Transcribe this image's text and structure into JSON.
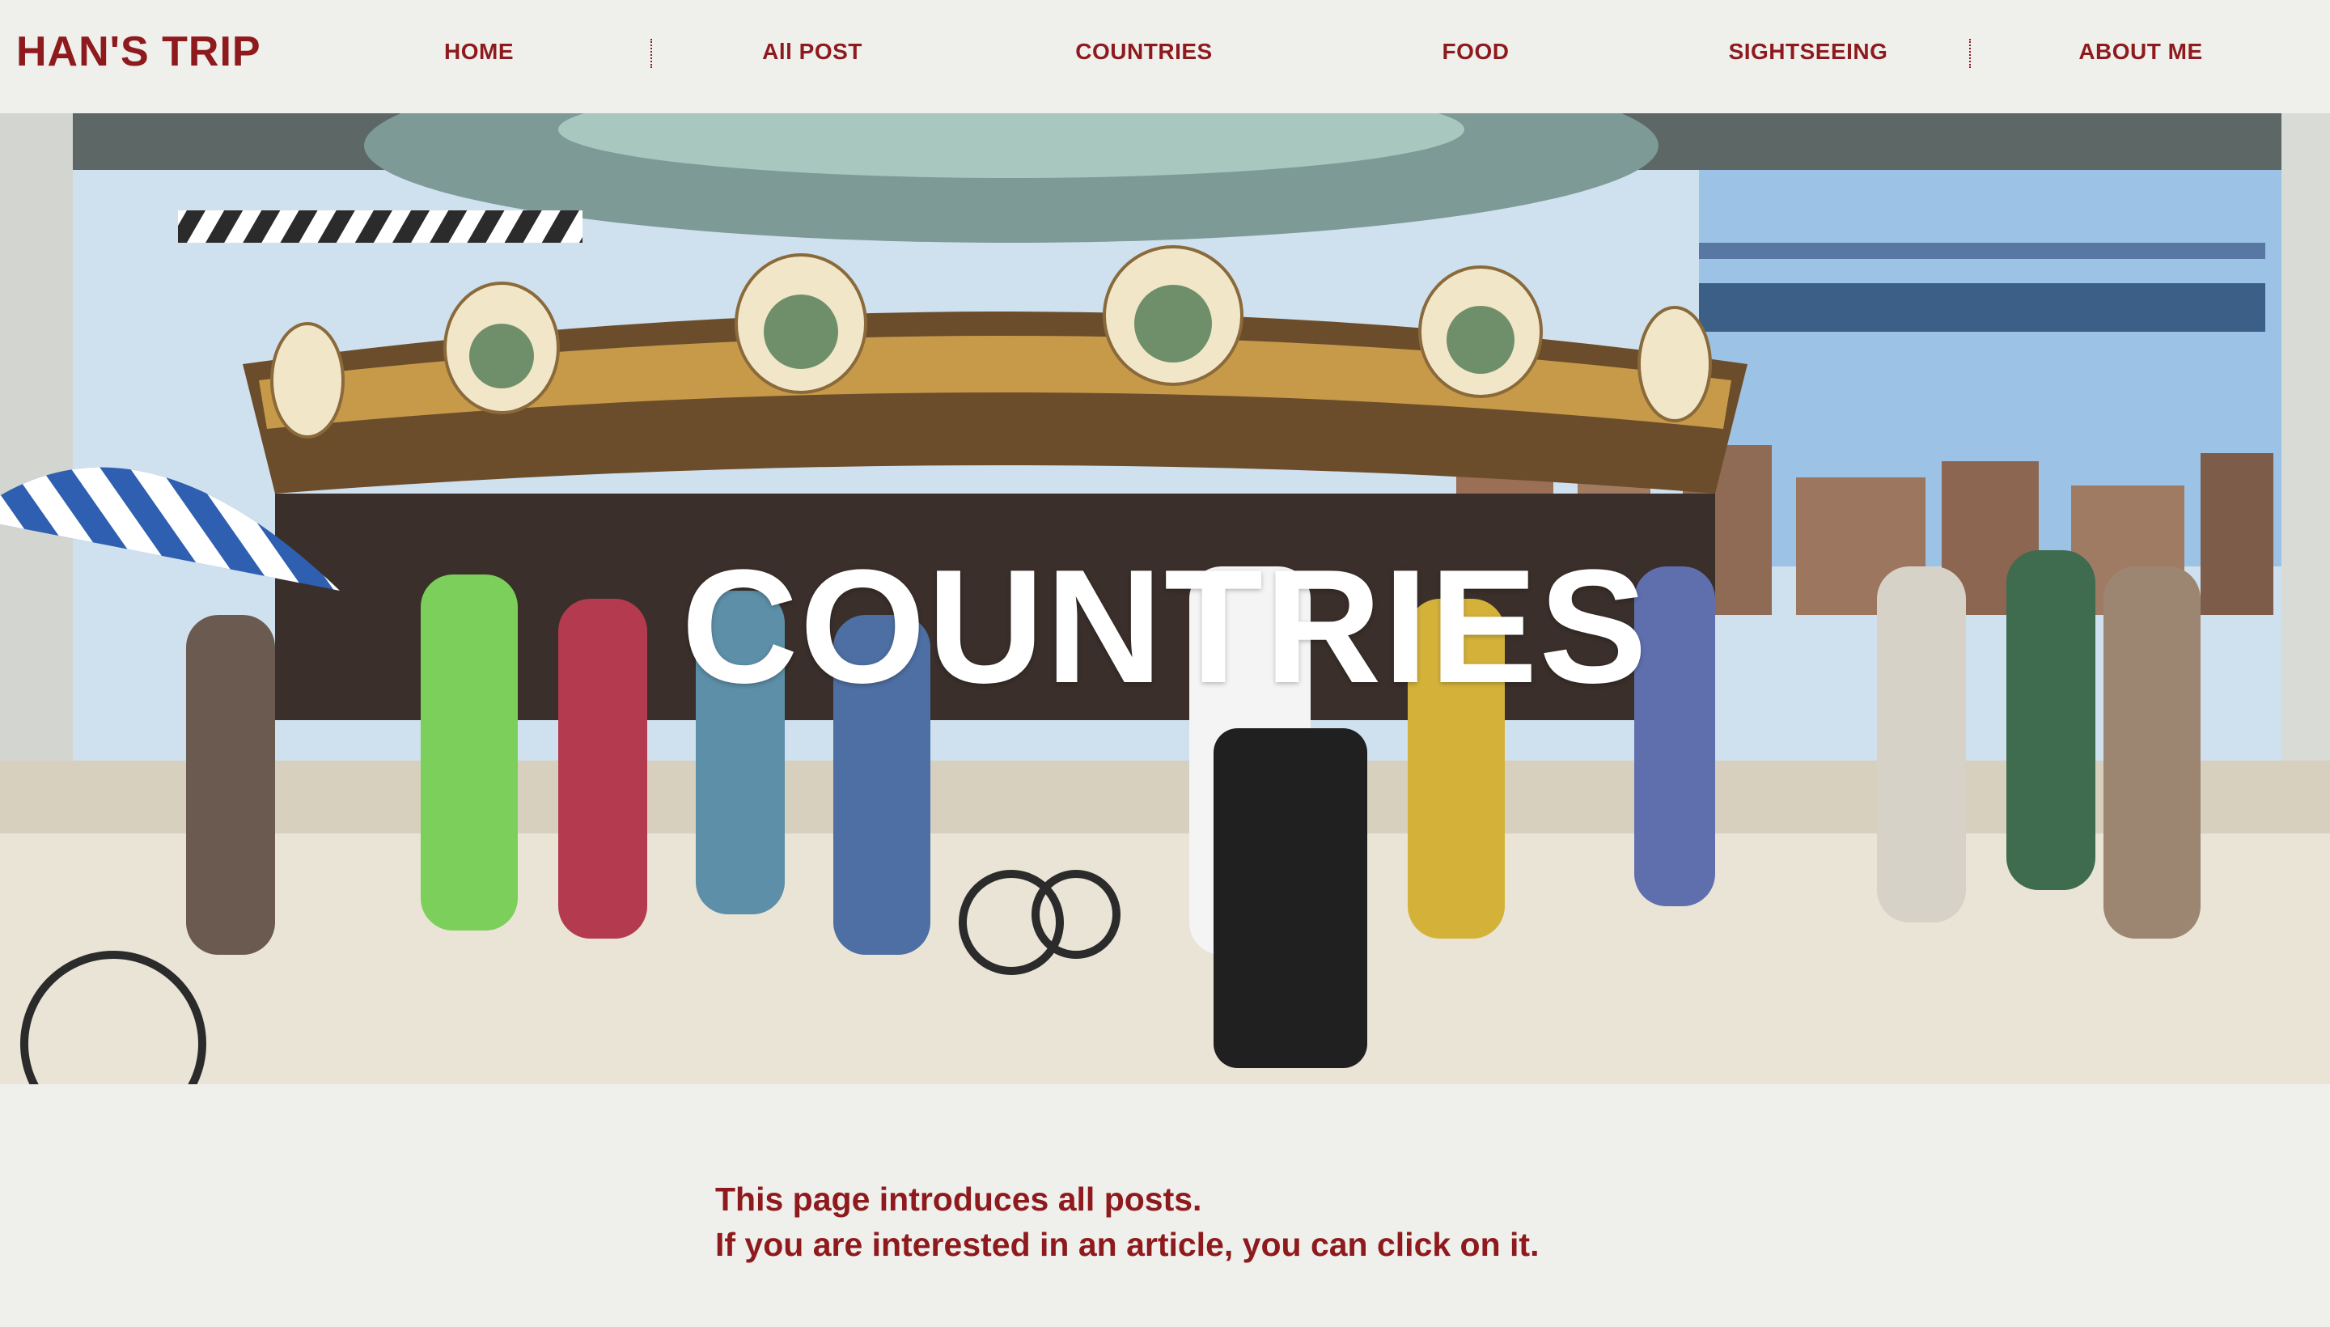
{
  "brand": "HAN'S TRIP",
  "nav": {
    "items": [
      {
        "label": "HOME"
      },
      {
        "label": "All POST"
      },
      {
        "label": "COUNTRIES"
      },
      {
        "label": "FOOD"
      },
      {
        "label": "SIGHTSEEING"
      },
      {
        "label": "ABOUT ME"
      }
    ]
  },
  "hero": {
    "title": "COUNTRIES",
    "image": "carousel-photo"
  },
  "intro": {
    "line1": "This page introduces all posts.",
    "line2": "If you are interested in an article, you can click on it."
  },
  "colors": {
    "brand": "#8e1a1d",
    "background": "#efefec",
    "hero_text": "#ffffff"
  }
}
